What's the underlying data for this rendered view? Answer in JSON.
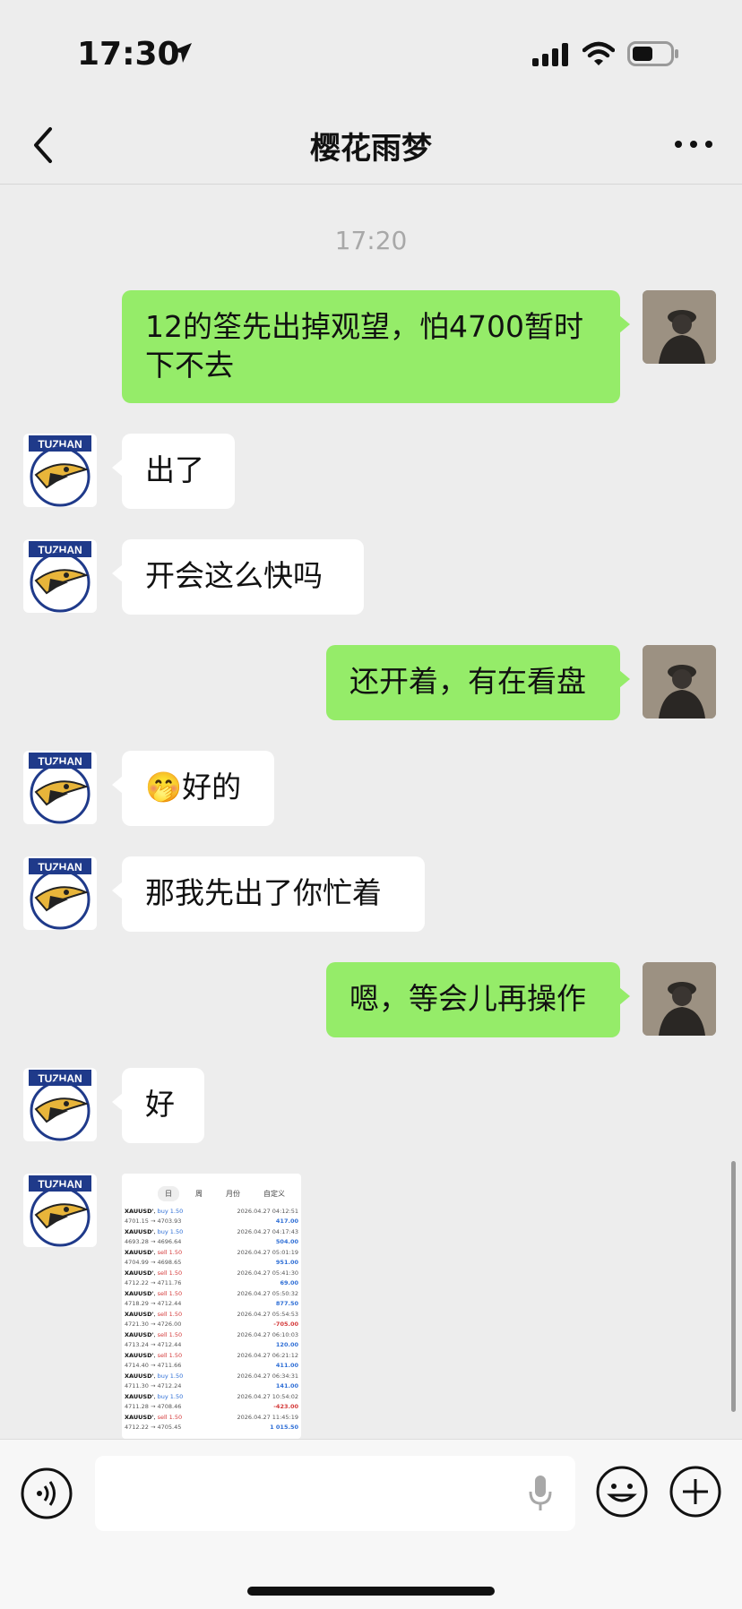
{
  "status": {
    "time": "17:30"
  },
  "nav": {
    "title": "樱花雨梦"
  },
  "timestamp": "17:20",
  "contact_badge": "TUZHAN",
  "messages": [
    {
      "side": "out",
      "text": "12的筌先出掉观望，怕4700暂时下不去"
    },
    {
      "side": "in",
      "text": "出了"
    },
    {
      "side": "in",
      "text": "开会这么快吗"
    },
    {
      "side": "out",
      "text": "还开着，有在看盘"
    },
    {
      "side": "in",
      "text": "好的",
      "emoji": "🤭"
    },
    {
      "side": "in",
      "text": "那我先出了你忙着"
    },
    {
      "side": "out",
      "text": "嗯，等会儿再操作"
    },
    {
      "side": "in",
      "text": "好"
    }
  ],
  "screenshot": {
    "tabs": [
      "日",
      "周",
      "月份",
      "自定义"
    ],
    "trades": [
      {
        "sym": "XAUUSD'",
        "side": "buy 1.50",
        "prices": "4701.15 → 4703.93",
        "date": "2026.04.27 04:12:51",
        "pnl": "417.00"
      },
      {
        "sym": "XAUUSD'",
        "side": "buy 1.50",
        "prices": "4693.28 → 4696.64",
        "date": "2026.04.27 04:17:43",
        "pnl": "504.00"
      },
      {
        "sym": "XAUUSD'",
        "side": "sell 1.50",
        "prices": "4704.99 → 4698.65",
        "date": "2026.04.27 05:01:19",
        "pnl": "951.00"
      },
      {
        "sym": "XAUUSD'",
        "side": "sell 1.50",
        "prices": "4712.22 → 4711.76",
        "date": "2026.04.27 05:41:30",
        "pnl": "69.00"
      },
      {
        "sym": "XAUUSD'",
        "side": "sell 1.50",
        "prices": "4718.29 → 4712.44",
        "date": "2026.04.27 05:50:32",
        "pnl": "877.50"
      },
      {
        "sym": "XAUUSD'",
        "side": "sell 1.50",
        "prices": "4721.30 → 4726.00",
        "date": "2026.04.27 05:54:53",
        "pnl": "-705.00"
      },
      {
        "sym": "XAUUSD'",
        "side": "sell 1.50",
        "prices": "4713.24 → 4712.44",
        "date": "2026.04.27 06:10:03",
        "pnl": "120.00"
      },
      {
        "sym": "XAUUSD'",
        "side": "sell 1.50",
        "prices": "4714.40 → 4711.66",
        "date": "2026.04.27 06:21:12",
        "pnl": "411.00"
      },
      {
        "sym": "XAUUSD'",
        "side": "buy 1.50",
        "prices": "4711.30 → 4712.24",
        "date": "2026.04.27 06:34:31",
        "pnl": "141.00"
      },
      {
        "sym": "XAUUSD'",
        "side": "buy 1.50",
        "prices": "4711.28 → 4708.46",
        "date": "2026.04.27 10:54:02",
        "pnl": "-423.00"
      },
      {
        "sym": "XAUUSD'",
        "side": "sell 1.50",
        "prices": "4712.22 → 4705.45",
        "date": "2026.04.27 11:45:19",
        "pnl": "1 015.50"
      }
    ]
  },
  "colors": {
    "incoming": "#ffffff",
    "outgoing": "#95ec69",
    "background": "#ededed",
    "buy": "#2f6fd6",
    "sell": "#d43a3a"
  }
}
